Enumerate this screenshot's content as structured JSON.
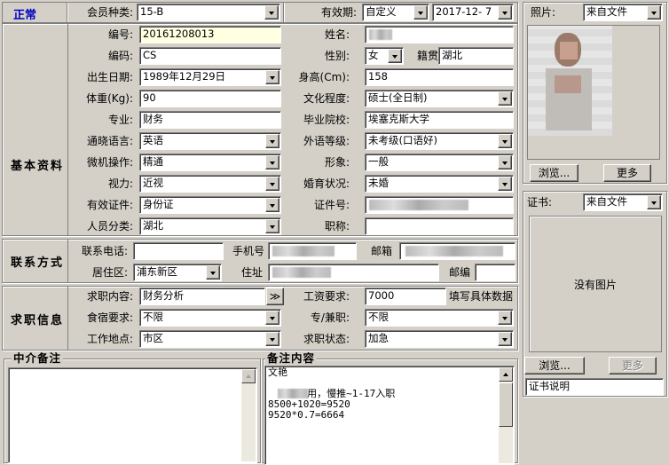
{
  "status": {
    "label": "正常",
    "color": "#0000c0"
  },
  "member_type": {
    "label": "会员种类:",
    "value": "15-B"
  },
  "validity": {
    "label": "有效期:",
    "type": "自定义",
    "date": "2017-12- 7"
  },
  "photo": {
    "label": "照片:",
    "source": "来自文件",
    "browse": "浏览...",
    "more": "更多"
  },
  "sections": {
    "basic": "基本资料",
    "contact": "联系方式",
    "job": "求职信息"
  },
  "basic": {
    "id": {
      "label": "编号:",
      "value": "20161208013"
    },
    "name": {
      "label": "姓名:"
    },
    "code": {
      "label": "编码:",
      "value": "CS"
    },
    "gender": {
      "label": "性别:",
      "value": "女"
    },
    "origin": {
      "label": "籍贯",
      "value": "湖北"
    },
    "birth": {
      "label": "出生日期:",
      "value": "1989年12月29日"
    },
    "height": {
      "label": "身高(Cm):",
      "value": "158"
    },
    "weight": {
      "label": "体重(Kg):",
      "value": "90"
    },
    "education": {
      "label": "文化程度:",
      "value": "硕士(全日制)"
    },
    "major": {
      "label": "专业:",
      "value": "财务"
    },
    "school": {
      "label": "毕业院校:",
      "value": "埃塞克斯大学"
    },
    "language": {
      "label": "通晓语言:",
      "value": "英语"
    },
    "lang_level": {
      "label": "外语等级:",
      "value": "未考级(口语好)"
    },
    "computer": {
      "label": "微机操作:",
      "value": "精通"
    },
    "appearance": {
      "label": "形象:",
      "value": "一般"
    },
    "eyesight": {
      "label": "视力:",
      "value": "近视"
    },
    "marital": {
      "label": "婚育状况:",
      "value": "未婚"
    },
    "id_doc": {
      "label": "有效证件:",
      "value": "身份证"
    },
    "id_num": {
      "label": "证件号:"
    },
    "category": {
      "label": "人员分类:",
      "value": "湖北"
    },
    "title": {
      "label": "职称:"
    }
  },
  "contact": {
    "phone": {
      "label": "联系电话:"
    },
    "mobile": {
      "label": "手机号"
    },
    "email": {
      "label": "邮箱"
    },
    "district": {
      "label": "居住区:",
      "value": "浦东新区"
    },
    "address": {
      "label": "住址"
    },
    "zip": {
      "label": "邮编"
    }
  },
  "job": {
    "position": {
      "label": "求职内容:",
      "value": "财务分析",
      "arrow_btn": "≫"
    },
    "salary": {
      "label": "工资要求:",
      "value": "7000",
      "hint": "填写具体数据"
    },
    "board": {
      "label": "食宿要求:",
      "value": "不限"
    },
    "fulltime": {
      "label": "专/兼职:",
      "value": "不限"
    },
    "location": {
      "label": "工作地点:",
      "value": "市区"
    },
    "state": {
      "label": "求职状态:",
      "value": "加急"
    }
  },
  "agency_note": {
    "label": "中介备注"
  },
  "remark": {
    "label": "备注内容",
    "lines": [
      "文艳",
      "",
      "     录用，慢推~1-17入职",
      "8500+1020=9520",
      "9520*0.7=6664"
    ]
  },
  "certificate": {
    "label": "证书:",
    "source": "来自文件",
    "empty": "没有图片",
    "browse": "浏览...",
    "more": "更多",
    "desc": "证书说明"
  }
}
